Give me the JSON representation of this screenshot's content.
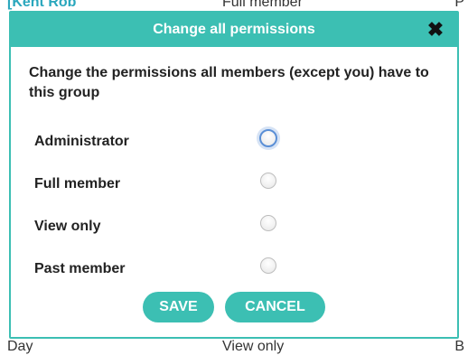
{
  "background": {
    "top_left": "[Kent Rob",
    "top_right": "Full member",
    "top_far_right": "P",
    "bottom_left": "Day",
    "bottom_mid": "View only",
    "bottom_right": "B"
  },
  "modal": {
    "title": "Change all permissions",
    "description": "Change the permissions all members (except you) have to this group",
    "options": [
      {
        "label": "Administrator"
      },
      {
        "label": "Full member"
      },
      {
        "label": "View only"
      },
      {
        "label": "Past member"
      }
    ],
    "buttons": {
      "save": "SAVE",
      "cancel": "CANCEL"
    },
    "colors": {
      "accent": "#3cbfb3"
    },
    "icons": {
      "close": "close-icon"
    }
  }
}
